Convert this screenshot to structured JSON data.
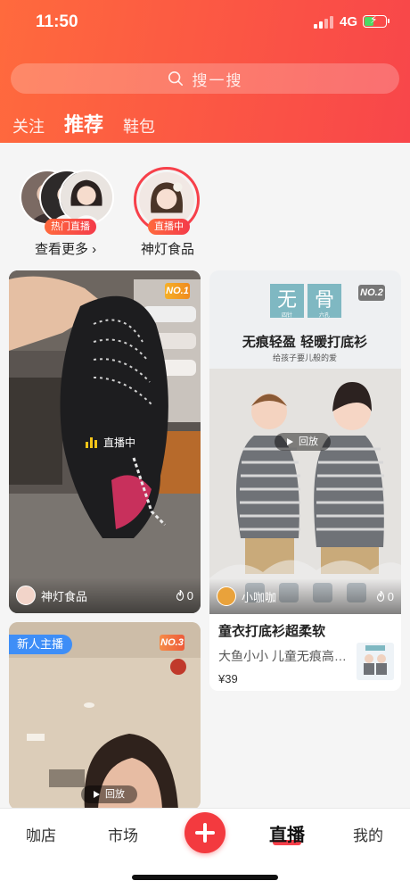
{
  "status_bar": {
    "time": "11:50",
    "network": "4G"
  },
  "search": {
    "placeholder": "搜一搜"
  },
  "tabs": [
    {
      "label": "关注"
    },
    {
      "label": "推荐",
      "active": true
    },
    {
      "label": "鞋包"
    }
  ],
  "live_strip": {
    "stack_badge": "热门直播",
    "see_more": "查看更多 ›",
    "streamer": {
      "badge": "直播中",
      "name": "神灯食品"
    }
  },
  "feed": [
    {
      "rank": "NO.1",
      "status": "直播中",
      "author": "神灯食品",
      "hot": "0"
    },
    {
      "rank": "NO.2",
      "status": "回放",
      "author": "小咖咖",
      "hot": "0",
      "poster": {
        "logo_left": "无",
        "logo_right": "骨",
        "logo_sub_left": "四针",
        "logo_sub_right": "六孔",
        "headline": "无痕轻盈 轻暖打底衫",
        "subline": "给孩子要儿般的爱"
      },
      "product": {
        "title": "童衣打底衫超柔软",
        "desc": "大鱼小小 儿童无痕高领打底衫",
        "price": "¥39"
      }
    },
    {
      "rank": "NO.3",
      "tag": "新人主播",
      "status": "回放"
    }
  ],
  "tabbar": [
    {
      "label": "咖店"
    },
    {
      "label": "市场"
    },
    {
      "label": "直播",
      "active": true
    },
    {
      "label": "我的"
    }
  ],
  "colors": {
    "brand": "#f8464a",
    "accent": "#ff6a3d",
    "live_bars": "#f5c518",
    "new_tag": "#3e8ef7"
  }
}
